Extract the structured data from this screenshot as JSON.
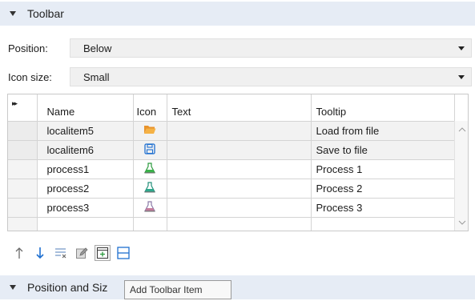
{
  "sections": {
    "toolbar": {
      "title": "Toolbar"
    },
    "position_and_size": {
      "title": "Position and Siz"
    }
  },
  "properties": {
    "position": {
      "label": "Position:",
      "value": "Below"
    },
    "icon_size": {
      "label": "Icon size:",
      "value": "Small"
    }
  },
  "table": {
    "columns": [
      "Name",
      "Icon",
      "Text",
      "Tooltip"
    ],
    "expander_glyph": "▸▸",
    "rows": [
      {
        "name": "localitem5",
        "icon": "folder-open-icon",
        "text": "",
        "tooltip": "Load from file"
      },
      {
        "name": "localitem6",
        "icon": "save-disk-icon",
        "text": "",
        "tooltip": "Save to file"
      },
      {
        "name": "process1",
        "icon": "flask-green-icon",
        "text": "",
        "tooltip": "Process 1"
      },
      {
        "name": "process2",
        "icon": "flask-teal-icon",
        "text": "",
        "tooltip": "Process 2"
      },
      {
        "name": "process3",
        "icon": "flask-purple-icon",
        "text": "",
        "tooltip": "Process 3"
      }
    ]
  },
  "bottom_toolbar": {
    "buttons": [
      "move-up-icon",
      "move-down-icon",
      "delete-rows-icon",
      "edit-icon",
      "add-toolbar-item-icon",
      "add-separator-icon"
    ]
  },
  "tooltip": {
    "text": "Add Toolbar Item"
  },
  "colors": {
    "section_bg": "#e6ecf5",
    "select_bg": "#f0f0f0",
    "accent_blue": "#1e6fd0",
    "folder_orange": "#f2a33a"
  }
}
